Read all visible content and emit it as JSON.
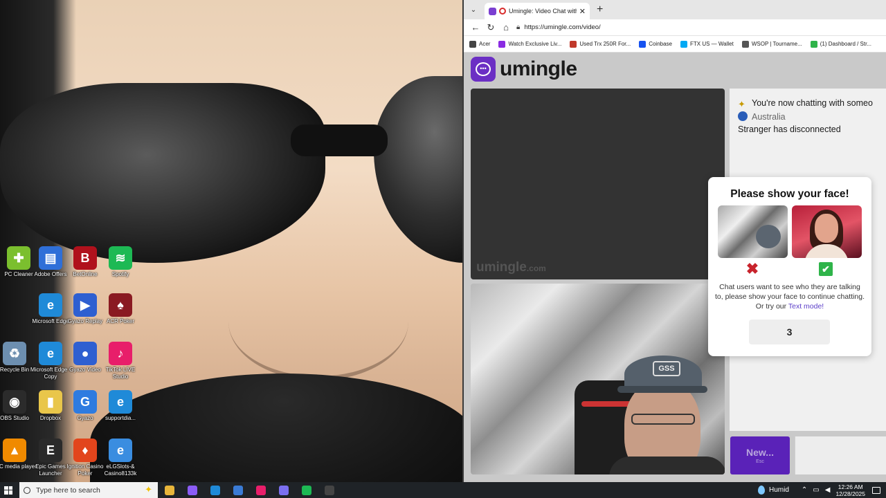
{
  "desktop": {
    "icons": [
      {
        "label": "PC Cleaner",
        "name": "pc-cleaner-icon",
        "color": "#7bbf2e",
        "glyph": "✚"
      },
      {
        "label": "Adobe Offers",
        "name": "adobe-offers-icon",
        "color": "#2f6fd8",
        "glyph": "▤"
      },
      {
        "label": "BetOnline",
        "name": "betonline-icon",
        "color": "#b0111c",
        "glyph": "B"
      },
      {
        "label": "Spotify",
        "name": "spotify-icon",
        "color": "#1db954",
        "glyph": "≋"
      },
      {
        "label": "Microsoft Edge",
        "name": "edge-icon",
        "color": "#1f8ad8",
        "glyph": "e"
      },
      {
        "label": "Gyazo Replay",
        "name": "gyazo-replay-icon",
        "color": "#2e5fd1",
        "glyph": "▶"
      },
      {
        "label": "ACR Poker",
        "name": "acr-poker-icon",
        "color": "#8a1a22",
        "glyph": "♠"
      },
      {
        "label": "Recycle Bin",
        "name": "recycle-bin-icon",
        "color": "#6d8fb0",
        "glyph": "♻"
      },
      {
        "label": "Microsoft Edge - Copy",
        "name": "edge-copy-icon",
        "color": "#1f8ad8",
        "glyph": "e"
      },
      {
        "label": "Gyazo Video",
        "name": "gyazo-video-icon",
        "color": "#2e5fd1",
        "glyph": "●"
      },
      {
        "label": "TikTok LIVE Studio",
        "name": "tiktok-live-studio-icon",
        "color": "#e81e6a",
        "glyph": "♪"
      },
      {
        "label": "OBS Studio",
        "name": "obs-studio-icon",
        "color": "#2b2b2b",
        "glyph": "◉"
      },
      {
        "label": "Dropbox",
        "name": "dropbox-folder-icon",
        "color": "#e9c64a",
        "glyph": "▮"
      },
      {
        "label": "Gyazo",
        "name": "gyazo-icon",
        "color": "#2e7be0",
        "glyph": "G"
      },
      {
        "label": "supportdia...",
        "name": "supportdia-icon",
        "color": "#1f8ad8",
        "glyph": "e"
      },
      {
        "label": "VLC media player",
        "name": "vlc-icon",
        "color": "#f08a00",
        "glyph": "▲"
      },
      {
        "label": "Epic Games Launcher",
        "name": "epic-games-icon",
        "color": "#2a2a2a",
        "glyph": "E"
      },
      {
        "label": "Ignition Casino Poker",
        "name": "ignition-poker-icon",
        "color": "#e2451c",
        "glyph": "♦"
      },
      {
        "label": "eLGSlots-& Casino8133k",
        "name": "elgslots-icon",
        "color": "#3a8de0",
        "glyph": "e"
      }
    ]
  },
  "browser": {
    "tab_title": "Umingle: Video Chat with Stra",
    "url": "https://umingle.com/video/",
    "bookmarks": [
      {
        "label": "Acer",
        "color": "#444444"
      },
      {
        "label": "Watch Exclusive Liv...",
        "color": "#8a2be2"
      },
      {
        "label": "Used Trx 250R For...",
        "color": "#c0392b"
      },
      {
        "label": "Coinbase",
        "color": "#1652f0"
      },
      {
        "label": "FTX US — Wallet",
        "color": "#02a9f4"
      },
      {
        "label": "WSOP | Tourname...",
        "color": "#555555"
      },
      {
        "label": "(1) Dashboard / Str...",
        "color": "#2fb44a"
      }
    ]
  },
  "umingle": {
    "logo_text": "umingle",
    "watermark": "umingle",
    "watermark_suffix": ".com",
    "chat": {
      "line1": "You're now chatting with someo",
      "line2": "Australia",
      "line3": "Stranger has disconnected"
    },
    "new_button": "New...",
    "new_hint": "Esc",
    "self_cap_text": "GSS",
    "modal": {
      "title": "Please show your face!",
      "desc_before": "Chat users want to see who they are talking to, please show your face to continue chatting. Or try our ",
      "link": "Text mode!",
      "countdown": "3"
    }
  },
  "taskbar": {
    "search_placeholder": "Type here to search",
    "weather": "Humid",
    "time": "12:26 AM",
    "date": "12/28/2025",
    "apps": [
      {
        "name": "file-explorer-app",
        "color": "#e8b53a"
      },
      {
        "name": "copilot-app",
        "color": "#8b5cf6"
      },
      {
        "name": "edge-app",
        "color": "#1f8ad8"
      },
      {
        "name": "store-app",
        "color": "#3a7bd5"
      },
      {
        "name": "tiktok-app",
        "color": "#e81e6a"
      },
      {
        "name": "discord-app",
        "color": "#7b6ff0"
      },
      {
        "name": "spotify-app",
        "color": "#1db954"
      },
      {
        "name": "obs-app",
        "color": "#444444"
      }
    ]
  }
}
